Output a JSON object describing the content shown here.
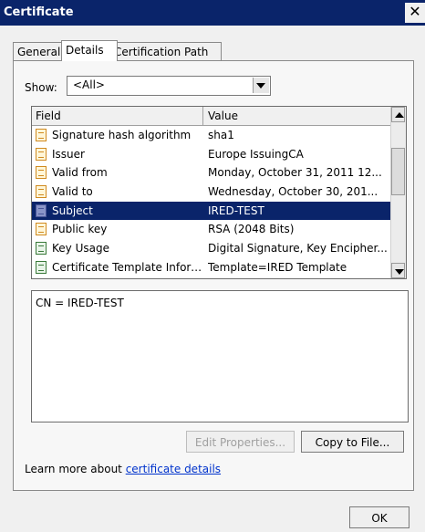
{
  "window": {
    "title": "Certificate",
    "close_glyph": "✕"
  },
  "tabs": [
    {
      "label": "General"
    },
    {
      "label": "Details"
    },
    {
      "label": "Certification Path"
    }
  ],
  "show": {
    "label": "Show:",
    "selected": "<All>"
  },
  "list": {
    "columns": {
      "field": "Field",
      "value": "Value"
    },
    "rows": [
      {
        "field": "Signature hash algorithm",
        "value": "sha1",
        "icon": "certificate-field-icon"
      },
      {
        "field": "Issuer",
        "value": "Europe IssuingCA",
        "icon": "certificate-field-icon"
      },
      {
        "field": "Valid from",
        "value": "Monday, October 31, 2011 12...",
        "icon": "certificate-field-icon"
      },
      {
        "field": "Valid to",
        "value": "Wednesday, October 30, 201...",
        "icon": "certificate-field-icon"
      },
      {
        "field": "Subject",
        "value": "IRED-TEST",
        "icon": "certificate-field-icon",
        "selected": true
      },
      {
        "field": "Public key",
        "value": "RSA (2048 Bits)",
        "icon": "certificate-field-icon"
      },
      {
        "field": "Key Usage",
        "value": "Digital Signature, Key Encipher...",
        "icon": "certificate-extension-icon"
      },
      {
        "field": "Certificate Template Inform...",
        "value": "Template=IRED Template",
        "icon": "certificate-extension-icon"
      }
    ]
  },
  "detail": {
    "text": "CN = IRED-TEST"
  },
  "buttons": {
    "edit_properties": "Edit Properties...",
    "copy_to_file": "Copy to File...",
    "ok": "OK"
  },
  "footer": {
    "learn_prefix": "Learn more about ",
    "learn_link": "certificate details"
  },
  "colors": {
    "titlebar": "#0a246a",
    "selection": "#0a246a",
    "link": "#0033cc"
  }
}
